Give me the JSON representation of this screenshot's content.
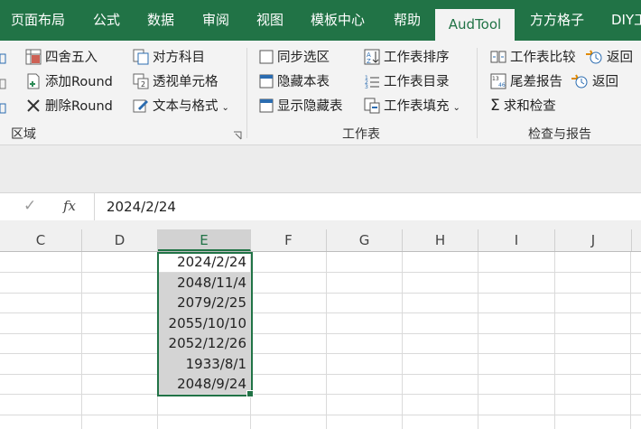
{
  "tabs": [
    "页面布局",
    "公式",
    "数据",
    "审阅",
    "视图",
    "模板中心",
    "帮助",
    "AudTool",
    "方方格子",
    "DIY工"
  ],
  "active_tab": "AudTool",
  "ribbon": {
    "col1": [
      "四舍五入",
      "添加Round",
      "删除Round"
    ],
    "col2": [
      "对方科目",
      "透视单元格",
      "文本与格式"
    ],
    "col3": [
      "同步选区",
      "隐藏本表",
      "显示隐藏表"
    ],
    "col4": [
      "工作表排序",
      "工作表目录",
      "工作表填充"
    ],
    "col5": [
      "工作表比较",
      "尾差报告",
      "求和检查"
    ],
    "col6": [
      "返回",
      "返回"
    ],
    "group_labels": [
      "区域",
      "工作表",
      "检查与报告"
    ]
  },
  "formula_bar": {
    "fx": "fx",
    "value": "2024/2/24"
  },
  "columns": [
    "C",
    "D",
    "E",
    "F",
    "G",
    "H",
    "I",
    "J"
  ],
  "selected_column": "E",
  "cells_E": [
    "2024/2/24",
    "2048/11/4",
    "2079/2/25",
    "2055/10/10",
    "2052/12/26",
    "1933/8/1",
    "2048/9/24"
  ],
  "colors": {
    "accent": "#217346",
    "selection": "#d4d4d4"
  }
}
